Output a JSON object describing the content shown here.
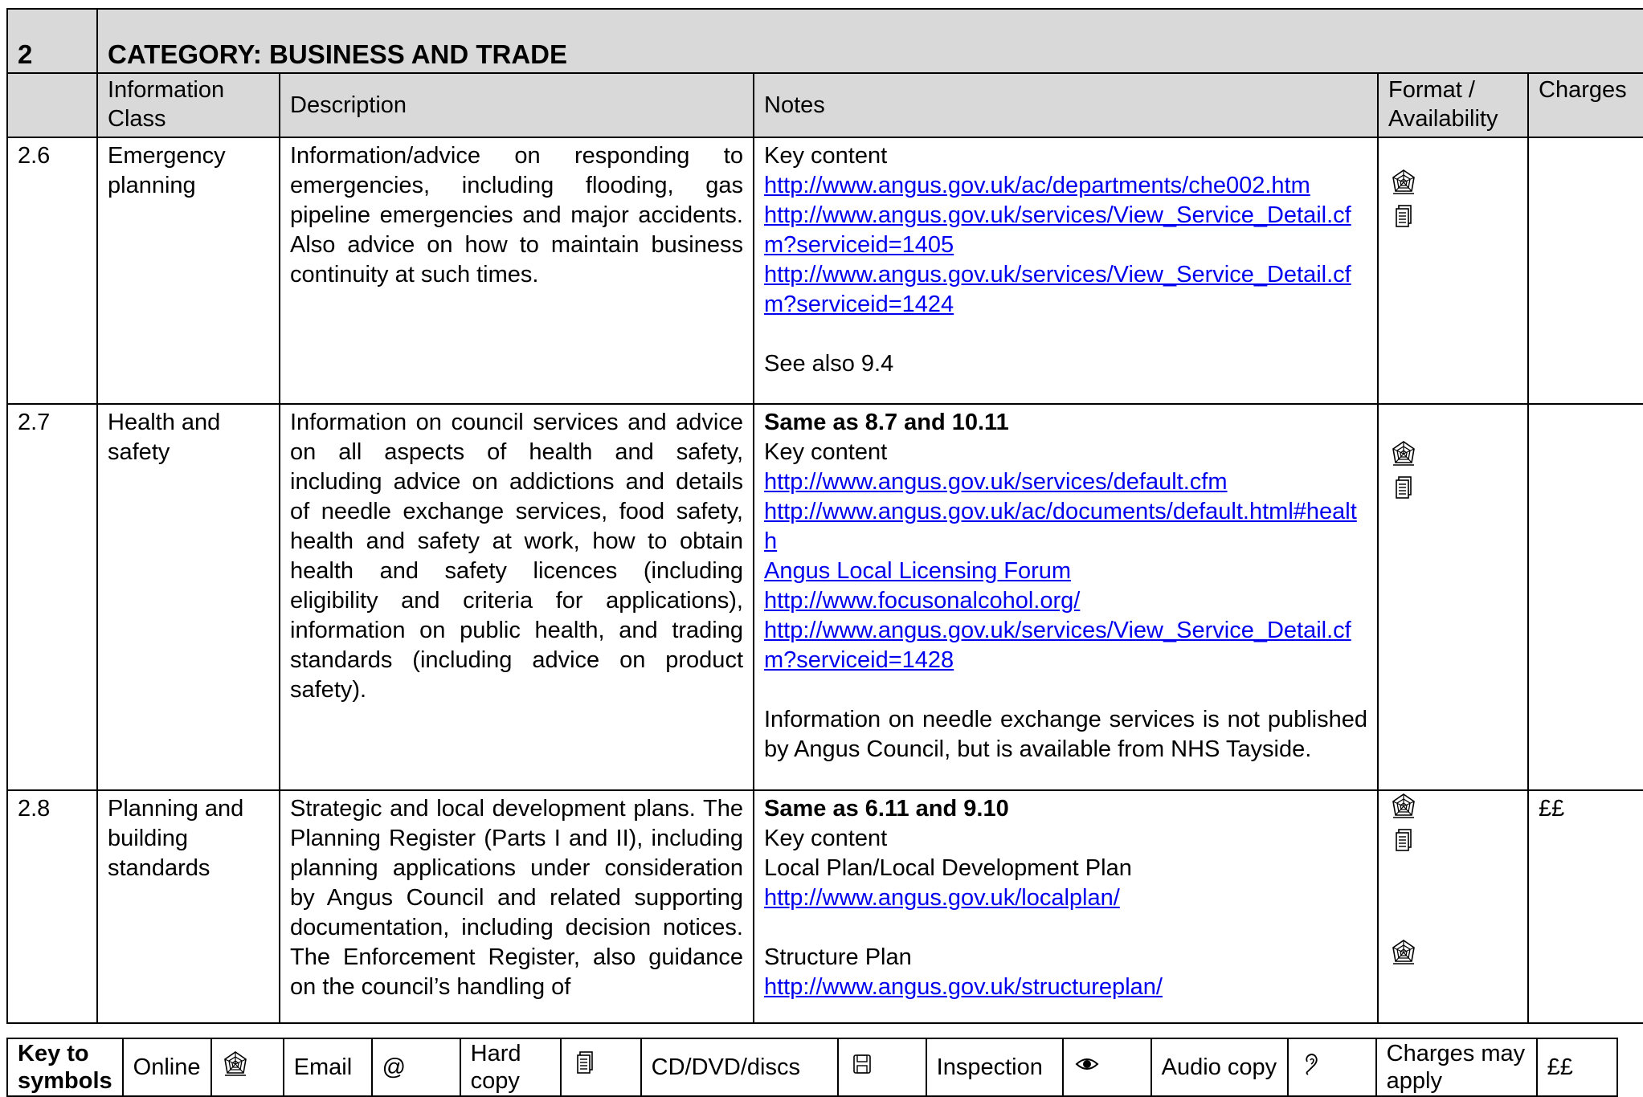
{
  "category": {
    "number": "2",
    "title": "CATEGORY: BUSINESS AND TRADE"
  },
  "headers": {
    "info_class": "Information Class",
    "description": "Description",
    "notes": "Notes",
    "format": "Format / Availability",
    "charges": "Charges"
  },
  "rows": [
    {
      "num": "2.6",
      "class": "Emergency planning",
      "description": "Information/advice on responding to emergencies, including flooding, gas pipeline emergencies and major accidents. Also advice on how to maintain business continuity at such times.",
      "notes": {
        "key_content": "Key content",
        "link1": "http://www.angus.gov.uk/ac/departments/che002.htm",
        "link2": "http://www.angus.gov.uk/services/View_Service_Detail.cfm?serviceid=1405",
        "link3": "http://www.angus.gov.uk/services/View_Service_Detail.cfm?serviceid=1424",
        "see_also": "See also 9.4"
      },
      "formats": [
        "online-icon",
        "hard-copy-icon"
      ],
      "charges": ""
    },
    {
      "num": "2.7",
      "class": "Health and safety",
      "description": "Information on council services and advice on all aspects of health and safety, including advice on addictions and details of needle exchange services, food safety, health and safety at work, how to obtain health and safety licences (including eligibility and criteria for applications), information on public health, and trading standards (including advice on product safety).",
      "notes": {
        "same_as": "Same as 8.7 and 10.11",
        "key_content": "Key content",
        "link1": "http://www.angus.gov.uk/services/default.cfm",
        "link2": "http://www.angus.gov.uk/ac/documents/default.html#health",
        "link3": "Angus Local Licensing Forum",
        "link4": "http://www.focusonalcohol.org/",
        "link5": "http://www.angus.gov.uk/services/View_Service_Detail.cfm?serviceid=1428",
        "needle_note": "Information on needle exchange services is not published by Angus Council, but is available from NHS Tayside."
      },
      "formats": [
        "online-icon",
        "hard-copy-icon"
      ],
      "charges": ""
    },
    {
      "num": "2.8",
      "class": "Planning and building standards",
      "description": "Strategic and local development plans. The Planning Register (Parts I and II), including planning applications under consideration by Angus Council and related supporting documentation, including decision notices. The Enforcement Register, also guidance on the council’s handling of",
      "notes": {
        "same_as": "Same as 6.11 and 9.10",
        "key_content": "Key content",
        "local_plan": "Local Plan/Local Development Plan",
        "link1": "http://www.angus.gov.uk/localplan/",
        "structure_plan": "Structure Plan",
        "link2": "http://www.angus.gov.uk/structureplan/"
      },
      "formats": [
        "online-icon",
        "hard-copy-icon",
        "online-icon"
      ],
      "charges": "££"
    }
  ],
  "key": {
    "label": "Key to symbols",
    "items": [
      {
        "label": "Online",
        "symbol": "online-icon"
      },
      {
        "label": "Email",
        "symbol": "@"
      },
      {
        "label": "Hard copy",
        "symbol": "hard-copy-icon"
      },
      {
        "label": "CD/DVD/discs",
        "symbol": "disk-icon"
      },
      {
        "label": "Inspection",
        "symbol": "eye-icon"
      },
      {
        "label": "Audio copy",
        "symbol": "ear-icon"
      },
      {
        "label": "Charges may apply",
        "symbol": "££"
      }
    ]
  },
  "colors": {
    "header_bg": "#d9d9d9",
    "link": "#0000ee"
  }
}
